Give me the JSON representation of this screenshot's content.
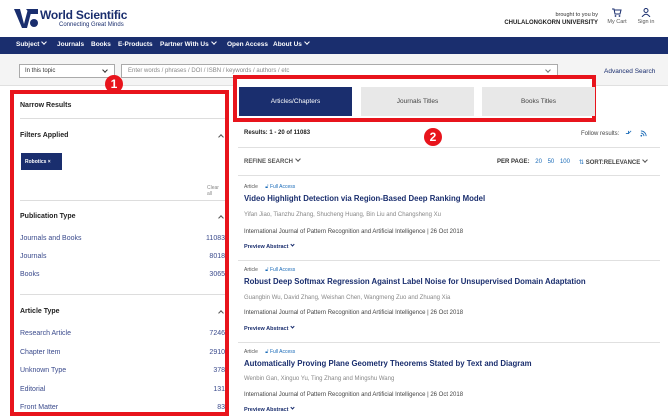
{
  "header": {
    "logo_text": "World Scientific",
    "logo_sub": "Connecting Great Minds",
    "brought_by": "brought to you by",
    "institution": "CHULALONGKORN UNIVERSITY",
    "cart_label": "My Cart",
    "signin_label": "Sign in"
  },
  "nav": {
    "items": [
      "Subject",
      "Journals",
      "Books",
      "E-Products",
      "Partner With Us",
      "Open Access",
      "About Us"
    ]
  },
  "search": {
    "scope": "In this topic",
    "placeholder": "Enter words / phrases / DOI / ISBN / keywords / authors / etc",
    "advanced": "Advanced Search"
  },
  "sidebar": {
    "title": "Narrow Results",
    "filters_applied": "Filters Applied",
    "chip": "Robotics ×",
    "clear": "Clear all",
    "pub_type_head": "Publication Type",
    "pub_types": [
      {
        "label": "Journals and Books",
        "count": "11083"
      },
      {
        "label": "Journals",
        "count": "8018"
      },
      {
        "label": "Books",
        "count": "3065"
      }
    ],
    "article_type_head": "Article Type",
    "article_types": [
      {
        "label": "Research Article",
        "count": "7246"
      },
      {
        "label": "Chapter Item",
        "count": "2910"
      },
      {
        "label": "Unknown Type",
        "count": "378"
      },
      {
        "label": "Editorial",
        "count": "131"
      },
      {
        "label": "Front Matter",
        "count": "83"
      }
    ]
  },
  "annotations": {
    "badge1": "1",
    "badge2": "2"
  },
  "tabs": [
    "Articles/Chapters",
    "Journals Titles",
    "Books Titles"
  ],
  "results": {
    "count_text": "Results: 1 - 20 of 11083",
    "follow": "Follow results:",
    "refine": "REFINE SEARCH",
    "per_page_label": "PER PAGE:",
    "per_page_options": [
      "20",
      "50",
      "100"
    ],
    "sort": "SORT:RELEVANCE",
    "items": [
      {
        "type": "Article",
        "access": "Full Access",
        "title": "Video Highlight Detection via Region-Based Deep Ranking Model",
        "authors": "Yifan Jiao, Tianzhu Zhang, Shucheng Huang, Bin Liu and Changsheng Xu",
        "journal": "International Journal of Pattern Recognition and Artificial Intelligence | 26 Oct 2018",
        "preview": "Preview Abstract"
      },
      {
        "type": "Article",
        "access": "Full Access",
        "title": "Robust Deep Softmax Regression Against Label Noise for Unsupervised Domain Adaptation",
        "authors": "Guangbin Wu, David Zhang, Weishan Chen, Wangmeng Zuo and Zhuang Xia",
        "journal": "International Journal of Pattern Recognition and Artificial Intelligence | 26 Oct 2018",
        "preview": "Preview Abstract"
      },
      {
        "type": "Article",
        "access": "Full Access",
        "title": "Automatically Proving Plane Geometry Theorems Stated by Text and Diagram",
        "authors": "Wenbin Gan, Xinguo Yu, Ting Zhang and Mingshu Wang",
        "journal": "International Journal of Pattern Recognition and Artificial Intelligence | 26 Oct 2018",
        "preview": "Preview Abstract"
      }
    ]
  }
}
